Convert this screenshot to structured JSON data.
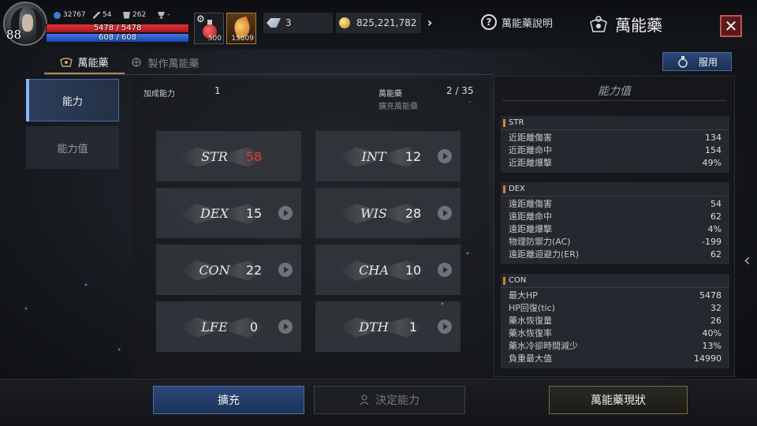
{
  "player": {
    "level": "88",
    "power": "32767",
    "stat_a": "54",
    "stat_b": "262",
    "stat_c": "-",
    "hp_text": "5478 / 5478",
    "mp_text": "608 / 608"
  },
  "items": {
    "potion_count": "500",
    "elixir_count": "15809"
  },
  "resources": {
    "gem_count": "3",
    "gold_count": "825,221,782"
  },
  "header": {
    "help_label": "萬能藥說明",
    "title": "萬能藥",
    "close_label": "✕"
  },
  "subtabs": [
    {
      "label": "萬能藥"
    },
    {
      "label": "製作萬能藥"
    }
  ],
  "use_button": {
    "label": "服用"
  },
  "sidebar": [
    {
      "label": "能力"
    },
    {
      "label": "能力值"
    }
  ],
  "center": {
    "bonus_label": "加成能力",
    "bonus_value": "1",
    "elixir_label": "萬能藥",
    "elixir_value": "2 / 35",
    "expand_label": "擴充萬能藥",
    "expand_value": "-",
    "stats": [
      {
        "name": "STR",
        "value": "58",
        "highlight": true
      },
      {
        "name": "INT",
        "value": "12"
      },
      {
        "name": "DEX",
        "value": "15"
      },
      {
        "name": "WIS",
        "value": "28"
      },
      {
        "name": "CON",
        "value": "22"
      },
      {
        "name": "CHA",
        "value": "10"
      },
      {
        "name": "LFE",
        "value": "0"
      },
      {
        "name": "DTH",
        "value": "1"
      }
    ]
  },
  "right_panel": {
    "title": "能力值",
    "blocks": [
      {
        "header": "STR",
        "rows": [
          {
            "label": "近距離傷害",
            "value": "134"
          },
          {
            "label": "近距離命中",
            "value": "154"
          },
          {
            "label": "近距離爆擊",
            "value": "49%"
          }
        ]
      },
      {
        "header": "DEX",
        "rows": [
          {
            "label": "遠距離傷害",
            "value": "54"
          },
          {
            "label": "遠距離命中",
            "value": "62"
          },
          {
            "label": "遠距離爆擊",
            "value": "4%"
          },
          {
            "label": "物理防禦力(AC)",
            "value": "-199"
          },
          {
            "label": "遠距離迴避力(ER)",
            "value": "62"
          }
        ]
      },
      {
        "header": "CON",
        "rows": [
          {
            "label": "最大HP",
            "value": "5478"
          },
          {
            "label": "HP回復(tic)",
            "value": "32"
          },
          {
            "label": "藥水恢復量",
            "value": "26"
          },
          {
            "label": "藥水恢復率",
            "value": "40%"
          },
          {
            "label": "藥水冷卻時間減少",
            "value": "13%"
          },
          {
            "label": "負重最大值",
            "value": "14990"
          }
        ]
      }
    ]
  },
  "bottom": {
    "expand_label": "擴充",
    "decide_label": "決定能力",
    "status_label": "萬能藥現狀"
  },
  "colors": {
    "accent_blue": "#2b4879",
    "highlight_red": "#e03a3a",
    "gold_border": "#7e6a3c",
    "section_marker": "#d9822b"
  }
}
